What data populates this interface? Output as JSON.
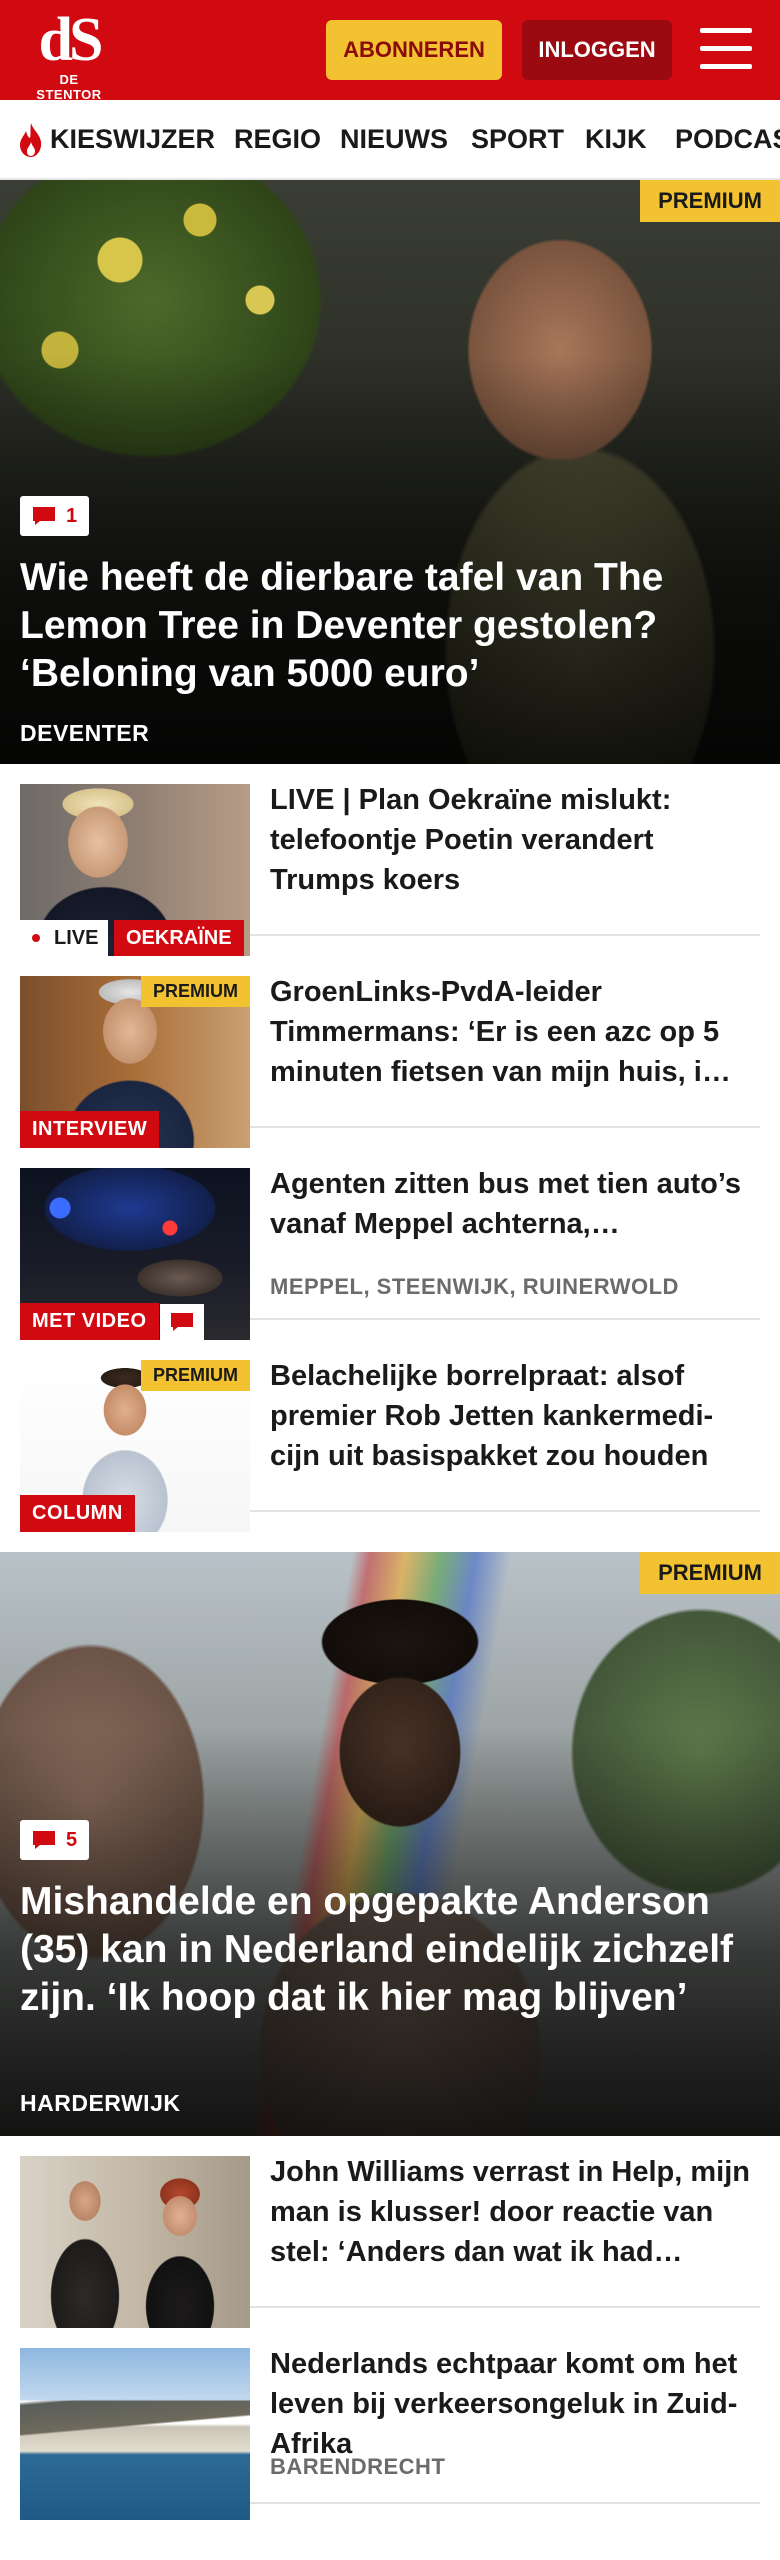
{
  "header": {
    "logo_mark": "dS",
    "logo_sub": "DE STENTOR",
    "subscribe_label": "ABONNEREN",
    "login_label": "INLOGGEN",
    "menu_icon": "hamburger-icon",
    "brand_color": "#d10a11",
    "accent_color": "#f2c230"
  },
  "nav": {
    "items": [
      "KIESWIJZER",
      "REGIO",
      "NIEUWS",
      "SPORT",
      "KIJK",
      "PODCAS"
    ],
    "highlight_icon": "flame-icon"
  },
  "hero1": {
    "premium": "PREMIUM",
    "comments": "1",
    "title": "Wie heeft de dierbare tafel van The Lemon Tree in Deventer gestolen? ‘Beloning van 5000 euro’",
    "location": "DEVENTER"
  },
  "articles": [
    {
      "title": "LIVE | Plan Oekraïne mislukt: telefoontje Poetin verandert Trumps koers",
      "live_label": "LIVE",
      "label": "OEKRAÏNE"
    },
    {
      "title": "GroenLinks-PvdA-leider Timmermans: ‘Er is een azc op 5 minuten fietsen van mijn huis, i…",
      "premium": "PREMIUM",
      "label": "INTERVIEW"
    },
    {
      "title": "Agenten zitten bus met tien auto’s vanaf Meppel achterna, achtervolging eindigt met een…",
      "label": "MET VIDEO",
      "location": "MEPPEL, STEENWIJK, RUINERWOLD"
    },
    {
      "title": "Belachelijke borrelpraat: alsof premier Rob Jetten kankermedi- cijn uit basispakket zou houden",
      "premium": "PREMIUM",
      "label": "COLUMN"
    }
  ],
  "hero2": {
    "premium": "PREMIUM",
    "comments": "5",
    "title": "Mishandelde en opgepakte Anderson (35) kan in Nederland eindelijk zichzelf zijn. ‘Ik hoop dat ik hier mag blijven’",
    "location": "HARDERWIJK"
  },
  "articles2": [
    {
      "title": "John Williams verrast in Help, mijn man is klusser! door reactie van stel: ‘Anders dan wat ik had…"
    },
    {
      "title": "Nederlands echtpaar komt om het leven bij verkeersongeluk in Zuid-Afrika",
      "location": "BARENDRECHT"
    }
  ]
}
